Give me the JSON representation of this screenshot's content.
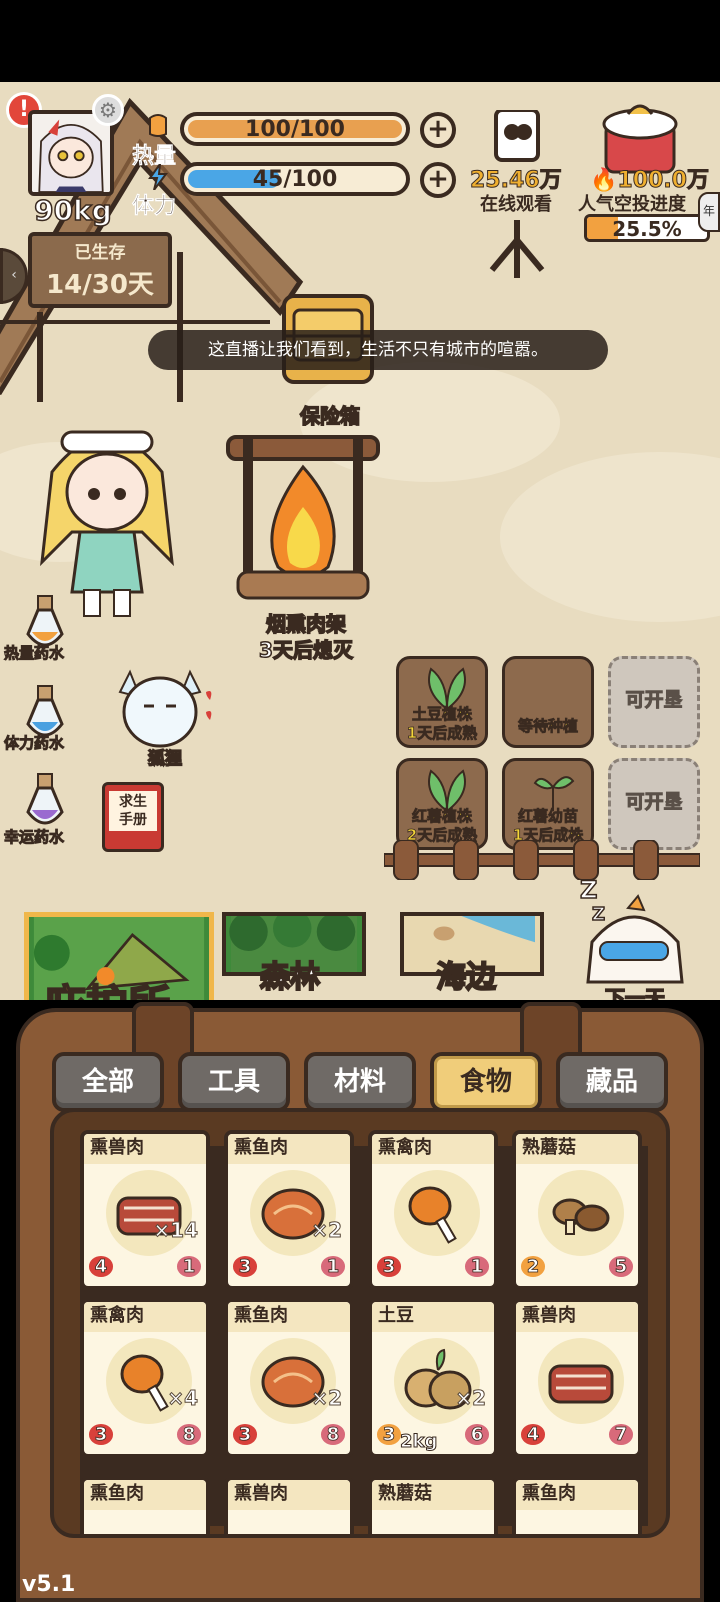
{
  "player": {
    "weight": "90kg"
  },
  "stats": {
    "heat": {
      "label": "热量",
      "value": "100/100",
      "fraction": 1.0
    },
    "stamina": {
      "label": "体力",
      "value": "45/100",
      "fraction": 0.45
    }
  },
  "survival": {
    "label": "已生存",
    "value": "14/30天"
  },
  "stream": {
    "viewers": "25.46万",
    "viewers_label": "在线观看",
    "popularity": "100.0万",
    "popularity_label": "人气空投进度",
    "progress_text": "25.5%",
    "progress": 0.255,
    "edge_tab": "年"
  },
  "toast": "这直播让我们看到，生活不只有城市的喧嚣。",
  "scene": {
    "safe_label": "保险箱",
    "fire_name": "烟熏肉架",
    "fire_status": "3天后熄灭",
    "fox_label": "狐狸",
    "manual_label_1": "求生",
    "manual_label_2": "手册",
    "next_day": "下一天"
  },
  "potions": [
    {
      "label": "热量药水",
      "color": "#f2a140"
    },
    {
      "label": "体力药水",
      "color": "#4aa0e0"
    },
    {
      "label": "幸运药水",
      "color": "#9a6ad0"
    }
  ],
  "plots": [
    {
      "line1": "土豆植株",
      "line2": "1天后成熟"
    },
    {
      "line1": "等待种植",
      "line2": ""
    },
    {
      "line1": "可开垦",
      "line2": ""
    },
    {
      "line1": "红薯植株",
      "line2": "2天后成熟"
    },
    {
      "line1": "红薯幼苗",
      "line2": "1天后成株"
    },
    {
      "line1": "可开垦",
      "line2": ""
    }
  ],
  "locations": {
    "shelter": "庇护所",
    "forest": "森林",
    "beach": "海边"
  },
  "categories": [
    "全部",
    "工具",
    "材料",
    "食物",
    "藏品"
  ],
  "active_category": "食物",
  "items": [
    {
      "name": "熏兽肉",
      "qty": "×14",
      "weight": "",
      "heat": "4",
      "stamina": "1"
    },
    {
      "name": "熏鱼肉",
      "qty": "×2",
      "weight": "",
      "heat": "3",
      "stamina": "1"
    },
    {
      "name": "熏禽肉",
      "qty": "",
      "weight": "",
      "heat": "3",
      "stamina": "1"
    },
    {
      "name": "熟蘑菇",
      "qty": "",
      "weight": "",
      "heat": "2",
      "stamina": "5"
    },
    {
      "name": "熏禽肉",
      "qty": "×4",
      "weight": "",
      "heat": "3",
      "stamina": "8"
    },
    {
      "name": "熏鱼肉",
      "qty": "×2",
      "weight": "",
      "heat": "3",
      "stamina": "8"
    },
    {
      "name": "土豆",
      "qty": "×2",
      "weight": "2kg",
      "heat": "3",
      "stamina": "6"
    },
    {
      "name": "熏兽肉",
      "qty": "",
      "weight": "",
      "heat": "4",
      "stamina": "7"
    },
    {
      "name": "熏鱼肉",
      "qty": "",
      "weight": "",
      "heat": "",
      "stamina": ""
    },
    {
      "name": "熏兽肉",
      "qty": "",
      "weight": "",
      "heat": "",
      "stamina": ""
    },
    {
      "name": "熟蘑菇",
      "qty": "",
      "weight": "",
      "heat": "",
      "stamina": ""
    },
    {
      "name": "熏鱼肉",
      "qty": "",
      "weight": "",
      "heat": "",
      "stamina": ""
    }
  ],
  "version": "v5.1",
  "colors": {
    "heat_bar": "#e8a050",
    "stamina_bar": "#4aa6e6",
    "accent": "#f0cd7a"
  }
}
